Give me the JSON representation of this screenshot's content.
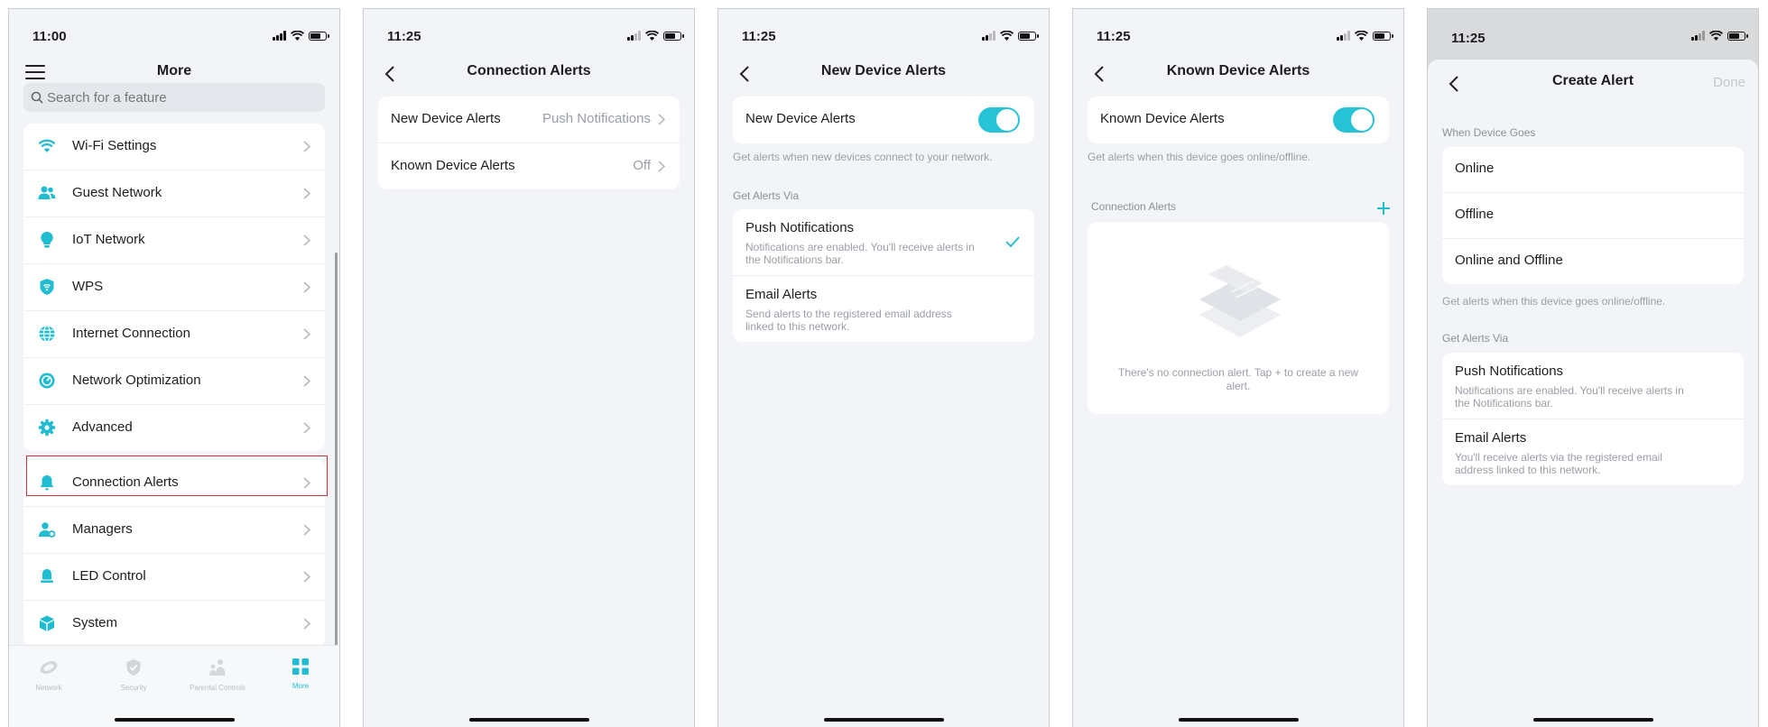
{
  "colors": {
    "accent": "#1fbcd2",
    "highlight": "#d5313b"
  },
  "screen1": {
    "time": "11:00",
    "title": "More",
    "search_placeholder": "Search for a feature",
    "items": [
      {
        "label": "Wi-Fi Settings",
        "icon": "wifi-icon"
      },
      {
        "label": "Guest Network",
        "icon": "guests-icon"
      },
      {
        "label": "IoT Network",
        "icon": "bulb-icon"
      },
      {
        "label": "WPS",
        "icon": "wps-shield-icon"
      },
      {
        "label": "Internet Connection",
        "icon": "globe-icon"
      },
      {
        "label": "Network Optimization",
        "icon": "optimization-icon"
      },
      {
        "label": "Advanced",
        "icon": "gear-icon"
      }
    ],
    "items2": [
      {
        "label": "Connection Alerts",
        "icon": "bell-icon"
      },
      {
        "label": "Managers",
        "icon": "manager-icon"
      },
      {
        "label": "LED Control",
        "icon": "led-icon"
      },
      {
        "label": "System",
        "icon": "box-icon"
      }
    ],
    "tabs": [
      {
        "label": "Network",
        "icon": "network-icon"
      },
      {
        "label": "Security",
        "icon": "security-shield-icon"
      },
      {
        "label": "Parental Controls",
        "icon": "family-icon"
      },
      {
        "label": "More",
        "icon": "grid-icon",
        "active": true
      }
    ]
  },
  "screen2": {
    "time": "11:25",
    "title": "Connection Alerts",
    "rows": [
      {
        "label": "New Device Alerts",
        "value": "Push Notifications"
      },
      {
        "label": "Known Device Alerts",
        "value": "Off"
      }
    ]
  },
  "screen3": {
    "time": "11:25",
    "title": "New Device Alerts",
    "toggle_label": "New Device Alerts",
    "toggle_on": true,
    "toggle_note": "Get alerts when new devices connect to your network.",
    "via_header": "Get Alerts Via",
    "options": [
      {
        "title": "Push Notifications",
        "desc": "Notifications are enabled. You'll receive alerts in the Notifications bar.",
        "checked": true
      },
      {
        "title": "Email Alerts",
        "desc": "Send alerts to the registered email address linked to this network.",
        "checked": false
      }
    ]
  },
  "screen4": {
    "time": "11:25",
    "title": "Known Device Alerts",
    "toggle_label": "Known Device Alerts",
    "toggle_on": true,
    "toggle_note": "Get alerts when this device goes online/offline.",
    "section": "Connection Alerts",
    "empty_text": "There's no connection alert. Tap + to create a new alert."
  },
  "screen5": {
    "time": "11:25",
    "title": "Create Alert",
    "done": "Done",
    "when_header": "When Device Goes",
    "when_options": [
      "Online",
      "Offline",
      "Online and Offline"
    ],
    "when_note": "Get alerts when this device goes online/offline.",
    "via_header": "Get Alerts Via",
    "options": [
      {
        "title": "Push Notifications",
        "desc": "Notifications are enabled. You'll receive alerts in the Notifications bar."
      },
      {
        "title": "Email Alerts",
        "desc": "You'll receive alerts via the registered email address linked to this network."
      }
    ]
  }
}
